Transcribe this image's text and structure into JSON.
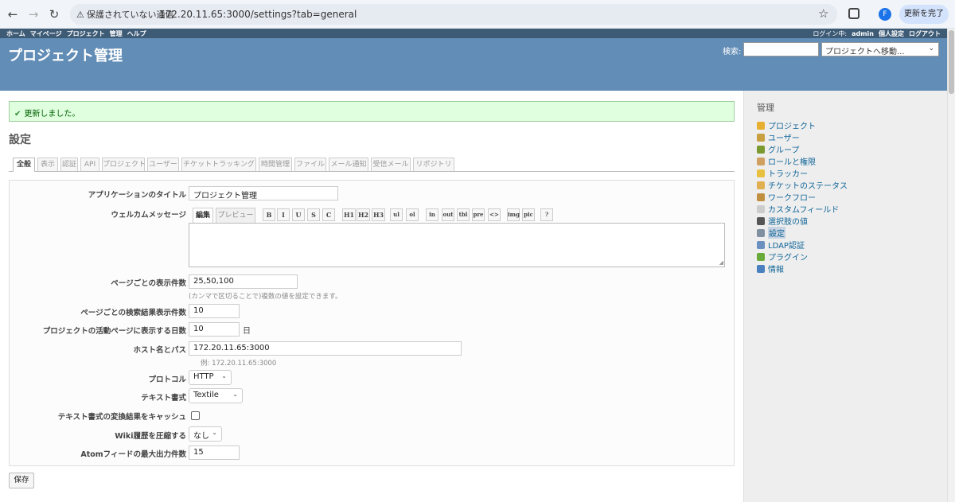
{
  "browser": {
    "security_warning": "保護されていない通信",
    "url": "172.20.11.65:3000/settings?tab=general",
    "profile_initial": "F",
    "update_label": "更新を完了"
  },
  "top_menu": {
    "left": [
      "ホーム",
      "マイページ",
      "プロジェクト",
      "管理",
      "ヘルプ"
    ],
    "login_label": "ログイン中:",
    "user": "admin",
    "my_account": "個人設定",
    "logout": "ログアウト"
  },
  "header": {
    "title": "プロジェクト管理",
    "search_label": "検索:",
    "jump_label": "プロジェクトへ移動..."
  },
  "flash": {
    "message": "更新しました。"
  },
  "page_title": "設定",
  "tabs": [
    "全般",
    "表示",
    "認証",
    "API",
    "プロジェクト",
    "ユーザー",
    "チケットトラッキング",
    "時間管理",
    "ファイル",
    "メール通知",
    "受信メール",
    "リポジトリ"
  ],
  "form": {
    "app_title_label": "アプリケーションのタイトル",
    "app_title_value": "プロジェクト管理",
    "welcome_label": "ウェルカムメッセージ",
    "welcome_tab_edit": "編集",
    "welcome_tab_preview": "プレビュー",
    "per_page_label": "ページごとの表示件数",
    "per_page_value": "25,50,100",
    "per_page_hint": "(カンマで区切ることで)複数の値を設定できます。",
    "search_per_page_label": "ページごとの検索結果表示件数",
    "search_per_page_value": "10",
    "activity_days_label": "プロジェクトの活動ページに表示する日数",
    "activity_days_value": "10",
    "activity_days_unit": "日",
    "host_label": "ホスト名とパス",
    "host_value": "172.20.11.65:3000",
    "host_hint": "例: 172.20.11.65:3000",
    "protocol_label": "プロトコル",
    "protocol_value": "HTTP",
    "text_format_label": "テキスト書式",
    "text_format_value": "Textile",
    "cache_label": "テキスト書式の変換結果をキャッシュ",
    "wiki_compress_label": "Wiki履歴を圧縮する",
    "wiki_compress_value": "なし",
    "atom_label": "Atomフィードの最大出力件数",
    "atom_value": "15",
    "save_label": "保存"
  },
  "toolbar": [
    "B",
    "I",
    "U",
    "S",
    "C",
    "H1",
    "H2",
    "H3",
    "ul",
    "ol",
    "in",
    "out",
    "tbl",
    "pre",
    "<>",
    "img",
    "pic",
    "?"
  ],
  "sidebar": {
    "title": "管理",
    "items": [
      "プロジェクト",
      "ユーザー",
      "グループ",
      "ロールと権限",
      "トラッカー",
      "チケットのステータス",
      "ワークフロー",
      "カスタムフィールド",
      "選択肢の値",
      "設定",
      "LDAP認証",
      "プラグイン",
      "情報"
    ],
    "icon_colors": [
      "#e8b030",
      "#c8a040",
      "#7a9a30",
      "#d0a060",
      "#e8c040",
      "#e0b050",
      "#c09040",
      "#cccccc",
      "#555555",
      "#8090a0",
      "#6a90c0",
      "#6aaa3a",
      "#4a80c0"
    ]
  }
}
